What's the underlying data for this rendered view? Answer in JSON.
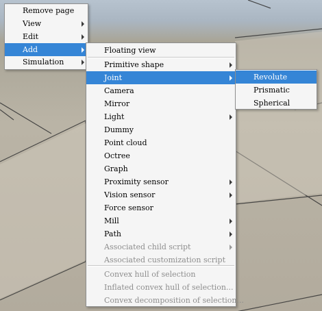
{
  "main_menu": {
    "items": [
      {
        "label": "Remove page",
        "submenu": false,
        "selected": false
      },
      {
        "label": "View",
        "submenu": true,
        "selected": false
      },
      {
        "label": "Edit",
        "submenu": true,
        "selected": false
      },
      {
        "label": "Add",
        "submenu": true,
        "selected": true
      },
      {
        "label": "Simulation",
        "submenu": true,
        "selected": false
      }
    ]
  },
  "add_menu": {
    "items": [
      {
        "label": "Floating view",
        "submenu": false,
        "selected": false,
        "disabled": false
      },
      {
        "label": "Primitive shape",
        "submenu": true,
        "selected": false,
        "disabled": false
      },
      {
        "label": "Joint",
        "submenu": true,
        "selected": true,
        "disabled": false
      },
      {
        "label": "Camera",
        "submenu": false,
        "selected": false,
        "disabled": false
      },
      {
        "label": "Mirror",
        "submenu": false,
        "selected": false,
        "disabled": false
      },
      {
        "label": "Light",
        "submenu": true,
        "selected": false,
        "disabled": false
      },
      {
        "label": "Dummy",
        "submenu": false,
        "selected": false,
        "disabled": false
      },
      {
        "label": "Point cloud",
        "submenu": false,
        "selected": false,
        "disabled": false
      },
      {
        "label": "Octree",
        "submenu": false,
        "selected": false,
        "disabled": false
      },
      {
        "label": "Graph",
        "submenu": false,
        "selected": false,
        "disabled": false
      },
      {
        "label": "Proximity sensor",
        "submenu": true,
        "selected": false,
        "disabled": false
      },
      {
        "label": "Vision sensor",
        "submenu": true,
        "selected": false,
        "disabled": false
      },
      {
        "label": "Force sensor",
        "submenu": false,
        "selected": false,
        "disabled": false
      },
      {
        "label": "Mill",
        "submenu": true,
        "selected": false,
        "disabled": false
      },
      {
        "label": "Path",
        "submenu": true,
        "selected": false,
        "disabled": false
      },
      {
        "label": "Associated child script",
        "submenu": true,
        "selected": false,
        "disabled": true
      },
      {
        "label": "Associated customization script",
        "submenu": false,
        "selected": false,
        "disabled": true
      },
      {
        "label": "Convex hull of selection",
        "submenu": false,
        "selected": false,
        "disabled": true
      },
      {
        "label": "Inflated convex hull of selection...",
        "submenu": false,
        "selected": false,
        "disabled": true
      },
      {
        "label": "Convex decomposition of selection...",
        "submenu": false,
        "selected": false,
        "disabled": true
      }
    ]
  },
  "joint_menu": {
    "items": [
      {
        "label": "Revolute",
        "submenu": false,
        "selected": true
      },
      {
        "label": "Prismatic",
        "submenu": false,
        "selected": false
      },
      {
        "label": "Spherical",
        "submenu": false,
        "selected": false
      }
    ]
  },
  "colors": {
    "highlight": "#3585d6",
    "menu_background": "#f5f5f5",
    "disabled_text": "#8d8d8d"
  }
}
